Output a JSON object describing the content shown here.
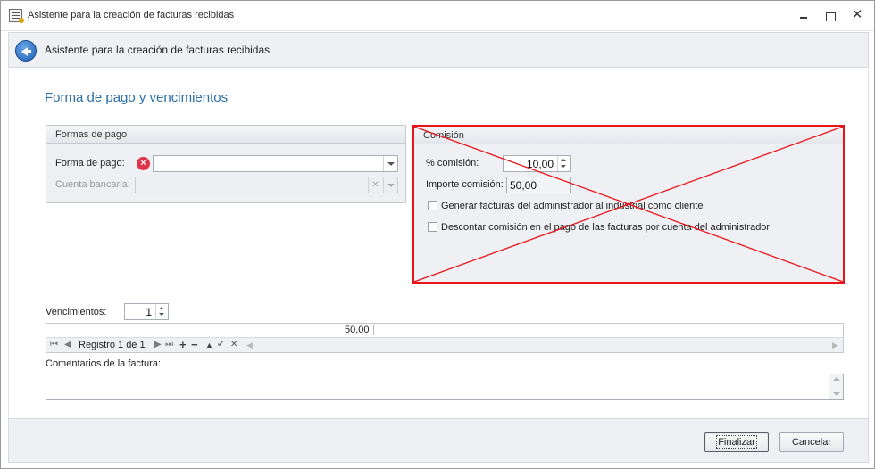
{
  "window": {
    "title": "Asistente para la creación de facturas recibidas",
    "minimize_icon": "minimize-icon",
    "maximize_icon": "restore-icon",
    "close_symbol": "✕"
  },
  "header": {
    "title": "Asistente para la creación de facturas recibidas",
    "back_icon": "back-arrow-icon"
  },
  "page": {
    "title": "Forma de pago y vencimientos"
  },
  "formas_pago": {
    "title": "Formas de pago",
    "forma_pago_label": "Forma de pago:",
    "forma_pago_value": "",
    "error_symbol": "×",
    "cuenta_label": "Cuenta bancaria:",
    "cuenta_value": "",
    "clear_symbol": "✕"
  },
  "comision": {
    "title": "Comisión",
    "pct_label": "% comisión:",
    "pct_value": "10,00",
    "importe_label": "Importe comisión:",
    "importe_value": "50,00",
    "generar_label": "Generar facturas del administrador al industrial como cliente",
    "generar_checked": false,
    "descontar_label": "Descontar comisión en el pago de las facturas por cuenta del administrador",
    "descontar_checked": false,
    "disabled_overlay": "red-x-overlay"
  },
  "vencimientos": {
    "label": "Vencimientos:",
    "value": "1",
    "grid_cell": "50,00",
    "navigator": {
      "first": "⏮",
      "prev": "◀",
      "record_text": "Registro 1 de 1",
      "next": "▶",
      "last": "⏭",
      "add": "+",
      "remove": "−",
      "edit": "▲",
      "save": "✔",
      "cancel": "✕",
      "scroll_left": "◀",
      "scroll_right": "▶"
    }
  },
  "comentarios": {
    "label": "Comentarios de la factura:",
    "value": ""
  },
  "footer": {
    "finish_label": "Finalizar",
    "cancel_label": "Cancelar"
  },
  "colors": {
    "accent_title": "#2a6fa8",
    "error_red": "#e0344a",
    "overlay_red": "#e8151b",
    "panel_bg": "#eef0f3"
  }
}
